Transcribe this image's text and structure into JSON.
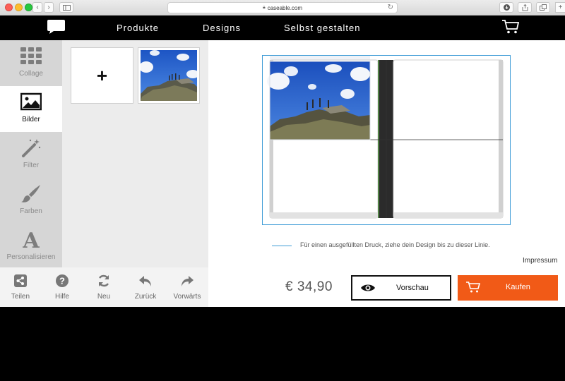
{
  "browser": {
    "url": "caseable.com",
    "buttons": [
      "back",
      "forward",
      "sidebar",
      "download",
      "share",
      "tabs",
      "new-tab"
    ]
  },
  "header": {
    "nav": [
      "Produkte",
      "Designs",
      "Selbst gestalten"
    ]
  },
  "tools": [
    {
      "label": "Collage",
      "icon": "grid-icon",
      "active": false
    },
    {
      "label": "Bilder",
      "icon": "image-icon",
      "active": true
    },
    {
      "label": "Filter",
      "icon": "magic-wand-icon",
      "active": false
    },
    {
      "label": "Farben",
      "icon": "paintbrush-icon",
      "active": false
    },
    {
      "label": "Personalisieren",
      "icon": "text-icon",
      "active": false
    }
  ],
  "gallery": {
    "add_label": "+"
  },
  "bottom_actions": [
    {
      "label": "Teilen",
      "icon": "share-icon"
    },
    {
      "label": "Hilfe",
      "icon": "help-icon"
    },
    {
      "label": "Neu",
      "icon": "refresh-icon"
    },
    {
      "label": "Zurück",
      "icon": "undo-icon"
    },
    {
      "label": "Vorwärts",
      "icon": "redo-icon"
    }
  ],
  "canvas": {
    "note": "Für einen ausgefüllten Druck, ziehe dein Design bis zu dieser Linie."
  },
  "footer": {
    "impressum": "Impressum",
    "price": "€ 34,90",
    "preview_label": "Vorschau",
    "buy_label": "Kaufen"
  },
  "colors": {
    "accent_orange": "#f15a17",
    "guide_blue": "#3d9bd6"
  }
}
